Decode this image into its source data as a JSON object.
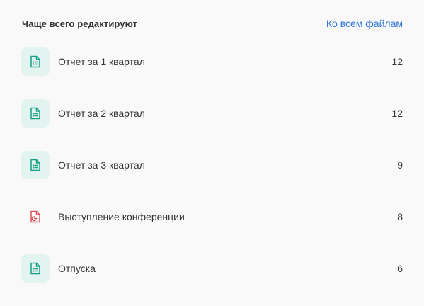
{
  "widget": {
    "title": "Чаще всего редактируют",
    "all_files_link": "Ко всем файлам"
  },
  "colors": {
    "link": "#2f76d9",
    "doc_icon": "#14a085",
    "doc_tile": "#e3f3f0",
    "pres_icon": "#e0525b",
    "text": "#333333",
    "background": "#f9f9f9"
  },
  "files": [
    {
      "name": "Отчет за 1 квартал",
      "count": "12",
      "icon": "document-icon"
    },
    {
      "name": "Отчет за 2 квартал",
      "count": "12",
      "icon": "document-icon"
    },
    {
      "name": "Отчет за 3 квартал",
      "count": "9",
      "icon": "document-icon"
    },
    {
      "name": "Выступление конференции",
      "count": "8",
      "icon": "presentation-icon"
    },
    {
      "name": "Отпуска",
      "count": "6",
      "icon": "document-icon"
    }
  ]
}
